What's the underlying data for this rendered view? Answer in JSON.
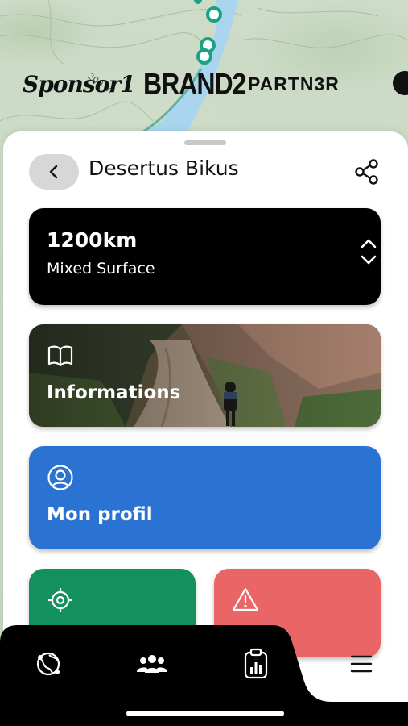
{
  "map": {
    "contour_label": "200 m",
    "sponsors": [
      "Sponsor1",
      "BRAND2",
      "PARTN3R"
    ]
  },
  "header": {
    "back_icon": "chevron-left-icon",
    "title": "Desertus Bikus",
    "share_icon": "share-icon"
  },
  "distance_card": {
    "value": "1200km",
    "surface": "Mixed Surface",
    "icon": "chevron-up-down-icon"
  },
  "info_card": {
    "label": "Informations",
    "icon": "book-open-icon"
  },
  "profile_card": {
    "label": "Mon profil",
    "icon": "user-circle-icon"
  },
  "tiles": [
    {
      "icon": "crosshair-icon",
      "color": "#12905e"
    },
    {
      "icon": "warning-icon",
      "color": "#e96566"
    }
  ],
  "nav": {
    "items": [
      "globe-route-icon",
      "group-icon",
      "clipboard-chart-icon",
      "menu-icon"
    ],
    "active": "menu-icon"
  },
  "colors": {
    "blue": "#2a73d2",
    "green": "#12905e",
    "red": "#e96566",
    "black": "#000000"
  }
}
